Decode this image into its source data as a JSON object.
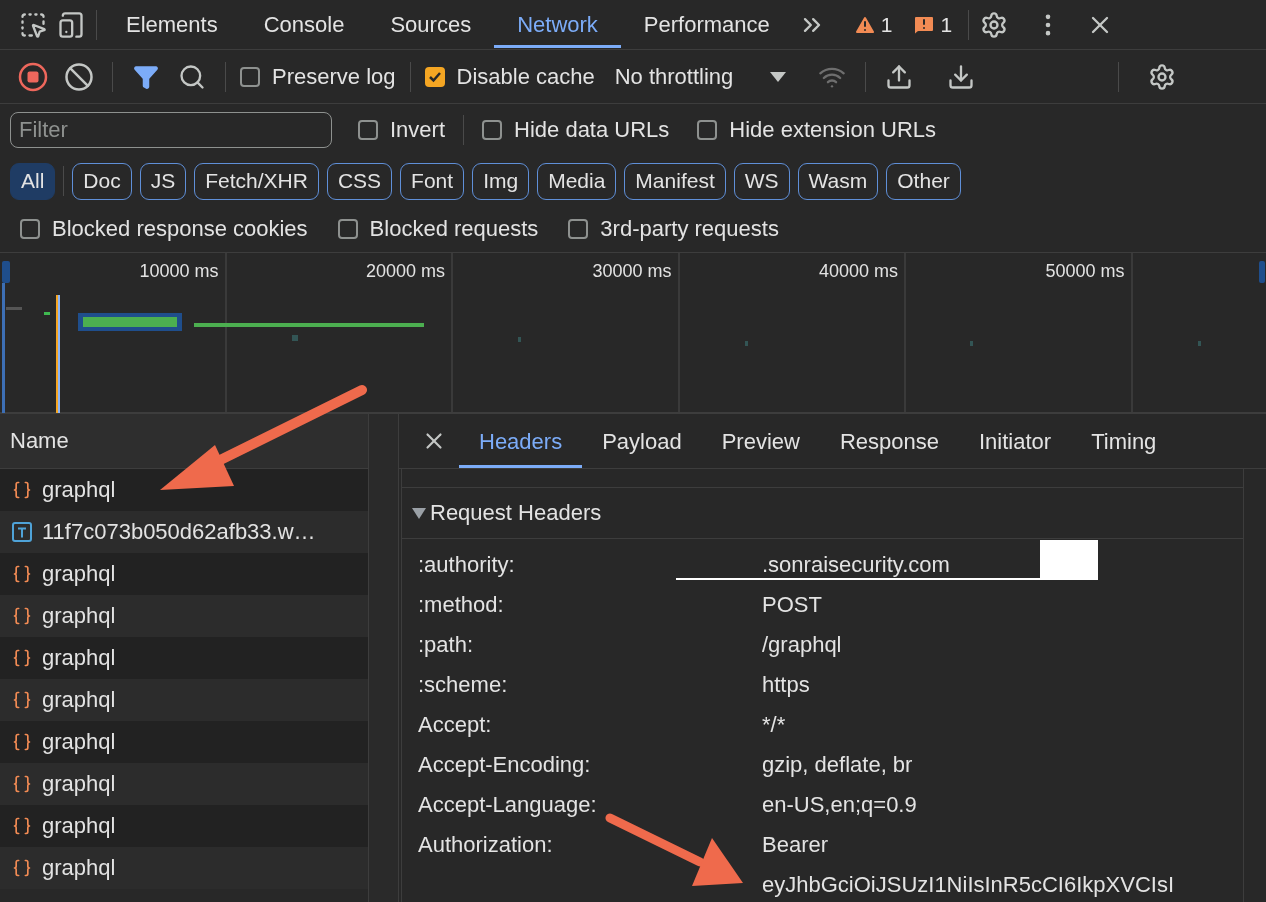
{
  "main_tabs": [
    {
      "label": "Elements",
      "selected": false
    },
    {
      "label": "Console",
      "selected": false
    },
    {
      "label": "Sources",
      "selected": false
    },
    {
      "label": "Network",
      "selected": true
    },
    {
      "label": "Performance",
      "selected": false
    }
  ],
  "issues": {
    "warnings": "1",
    "errors": "1"
  },
  "toolbar": {
    "recording": true,
    "preserve_log": {
      "label": "Preserve log",
      "checked": false
    },
    "disable_cache": {
      "label": "Disable cache",
      "checked": true
    },
    "throttling": "No throttling"
  },
  "filter_bar": {
    "placeholder": "Filter",
    "options": [
      {
        "label": "Invert",
        "checked": false
      },
      {
        "label": "Hide data URLs",
        "checked": false
      },
      {
        "label": "Hide extension URLs",
        "checked": false
      }
    ]
  },
  "type_filters": [
    {
      "label": "All",
      "selected": true
    },
    {
      "label": "Doc",
      "selected": false
    },
    {
      "label": "JS",
      "selected": false
    },
    {
      "label": "Fetch/XHR",
      "selected": false
    },
    {
      "label": "CSS",
      "selected": false
    },
    {
      "label": "Font",
      "selected": false
    },
    {
      "label": "Img",
      "selected": false
    },
    {
      "label": "Media",
      "selected": false
    },
    {
      "label": "Manifest",
      "selected": false
    },
    {
      "label": "WS",
      "selected": false
    },
    {
      "label": "Wasm",
      "selected": false
    },
    {
      "label": "Other",
      "selected": false
    }
  ],
  "extra_filters": [
    {
      "label": "Blocked response cookies",
      "checked": false
    },
    {
      "label": "Blocked requests",
      "checked": false
    },
    {
      "label": "3rd-party requests",
      "checked": false
    }
  ],
  "timeline": {
    "ticks": [
      "10000 ms",
      "20000 ms",
      "30000 ms",
      "40000 ms",
      "50000 ms"
    ]
  },
  "requests": {
    "column": "Name",
    "rows": [
      {
        "name": "graphql",
        "kind": "fetch"
      },
      {
        "name": "11f7c073b050d62afb33.w…",
        "kind": "text"
      },
      {
        "name": "graphql",
        "kind": "fetch"
      },
      {
        "name": "graphql",
        "kind": "fetch"
      },
      {
        "name": "graphql",
        "kind": "fetch"
      },
      {
        "name": "graphql",
        "kind": "fetch"
      },
      {
        "name": "graphql",
        "kind": "fetch"
      },
      {
        "name": "graphql",
        "kind": "fetch"
      },
      {
        "name": "graphql",
        "kind": "fetch"
      },
      {
        "name": "graphql",
        "kind": "fetch"
      }
    ]
  },
  "detail_tabs": [
    {
      "label": "Headers",
      "selected": true
    },
    {
      "label": "Payload",
      "selected": false
    },
    {
      "label": "Preview",
      "selected": false
    },
    {
      "label": "Response",
      "selected": false
    },
    {
      "label": "Initiator",
      "selected": false
    },
    {
      "label": "Timing",
      "selected": false
    }
  ],
  "request_headers": {
    "title": "Request Headers",
    "expanded": true,
    "rows": [
      {
        "name": ":authority:",
        "value": ".sonraisecurity.com",
        "redacted": true
      },
      {
        "name": ":method:",
        "value": "POST",
        "redacted": false
      },
      {
        "name": ":path:",
        "value": "/graphql",
        "redacted": false
      },
      {
        "name": ":scheme:",
        "value": "https",
        "redacted": false
      },
      {
        "name": "Accept:",
        "value": "*/*",
        "redacted": false
      },
      {
        "name": "Accept-Encoding:",
        "value": "gzip, deflate, br",
        "redacted": false
      },
      {
        "name": "Accept-Language:",
        "value": "en-US,en;q=0.9",
        "redacted": false
      },
      {
        "name": "Authorization:",
        "value": "Bearer",
        "redacted": false
      },
      {
        "name": "",
        "value": "eyJhbGciOiJSUzI1NiIsInR5cCI6IkpXVCIsI",
        "redacted": false
      }
    ]
  }
}
